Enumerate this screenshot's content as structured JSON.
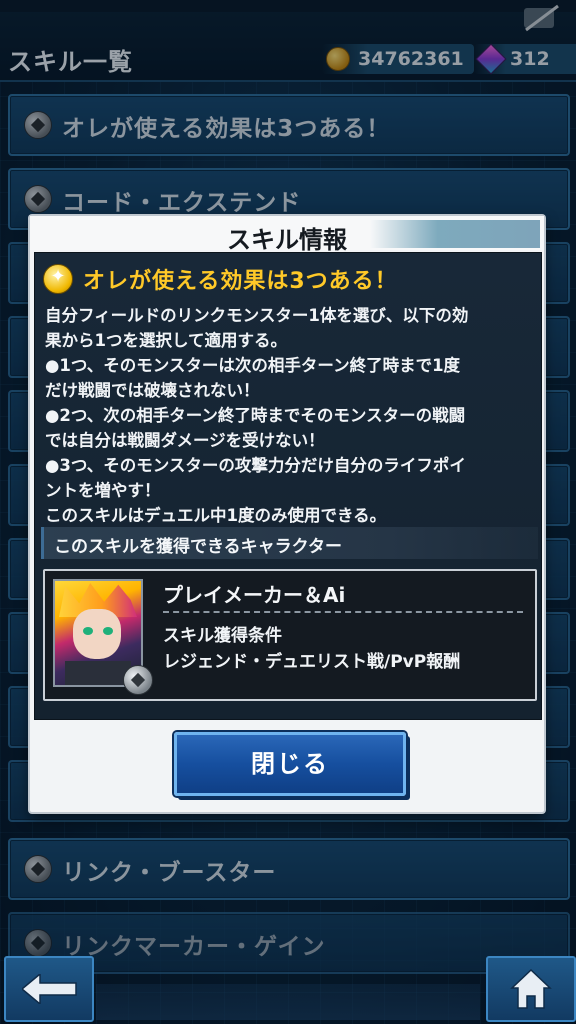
{
  "header": {
    "title": "スキル一覧",
    "gold": "34762361",
    "gems": "312"
  },
  "list": {
    "items": [
      {
        "label": "オレが使える効果は3つある！"
      },
      {
        "label": "コード・エクステンド"
      },
      {
        "label": "リンク・ブースター"
      },
      {
        "label": "リンクマーカー・ゲイン"
      }
    ]
  },
  "modal": {
    "title": "スキル情報",
    "skill_name": "オレが使える効果は3つある！",
    "description_lines": [
      "自分フィールドのリンクモンスター1体を選び、以下の効",
      "果から1つを選択して適用する。",
      "●1つ、そのモンスターは次の相手ターン終了時まで1度",
      "だけ戦闘では破壊されない！",
      "●2つ、次の相手ターン終了時までそのモンスターの戦闘",
      "では自分は戦闘ダメージを受けない！",
      "●3つ、そのモンスターの攻撃力分だけ自分のライフポイ",
      "ントを増やす！",
      "このスキルはデュエル中1度のみ使用できる。"
    ],
    "section_label": "このスキルを獲得できるキャラクター",
    "character": {
      "name": "プレイメーカー＆Ai",
      "condition_title": "スキル獲得条件",
      "condition_value": "レジェンド・デュエリスト戦/PvP報酬"
    },
    "close_label": "閉じる"
  },
  "icons": {
    "coin": "coin-icon",
    "gem": "gem-icon",
    "skill_star": "star-icon",
    "back": "back-arrow-icon",
    "home": "home-icon"
  },
  "colors": {
    "accent_gold": "#ffc928",
    "button_blue": "#164f9f",
    "panel_dark": "#182838"
  }
}
